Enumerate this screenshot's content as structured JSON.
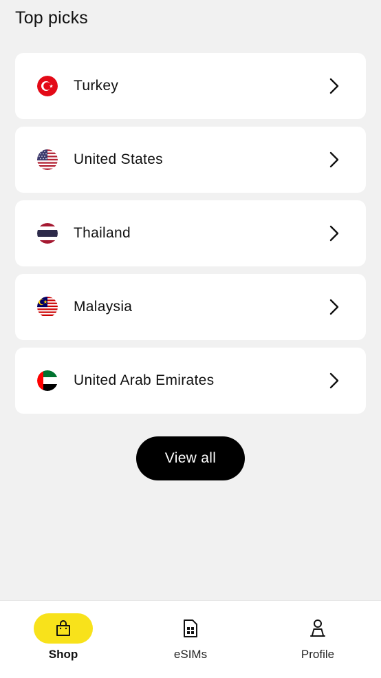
{
  "section": {
    "title": "Top picks"
  },
  "countries": [
    {
      "name": "Turkey",
      "flag": "turkey-flag-icon"
    },
    {
      "name": "United States",
      "flag": "usa-flag-icon"
    },
    {
      "name": "Thailand",
      "flag": "thailand-flag-icon"
    },
    {
      "name": "Malaysia",
      "flag": "malaysia-flag-icon"
    },
    {
      "name": "United Arab Emirates",
      "flag": "uae-flag-icon"
    }
  ],
  "view_all": {
    "label": "View all"
  },
  "nav": {
    "active": "Shop",
    "accent_color": "#f8e21b",
    "items": [
      {
        "label": "Shop",
        "icon": "shopping-bag-icon"
      },
      {
        "label": "eSIMs",
        "icon": "sim-card-icon"
      },
      {
        "label": "Profile",
        "icon": "person-icon"
      }
    ]
  }
}
